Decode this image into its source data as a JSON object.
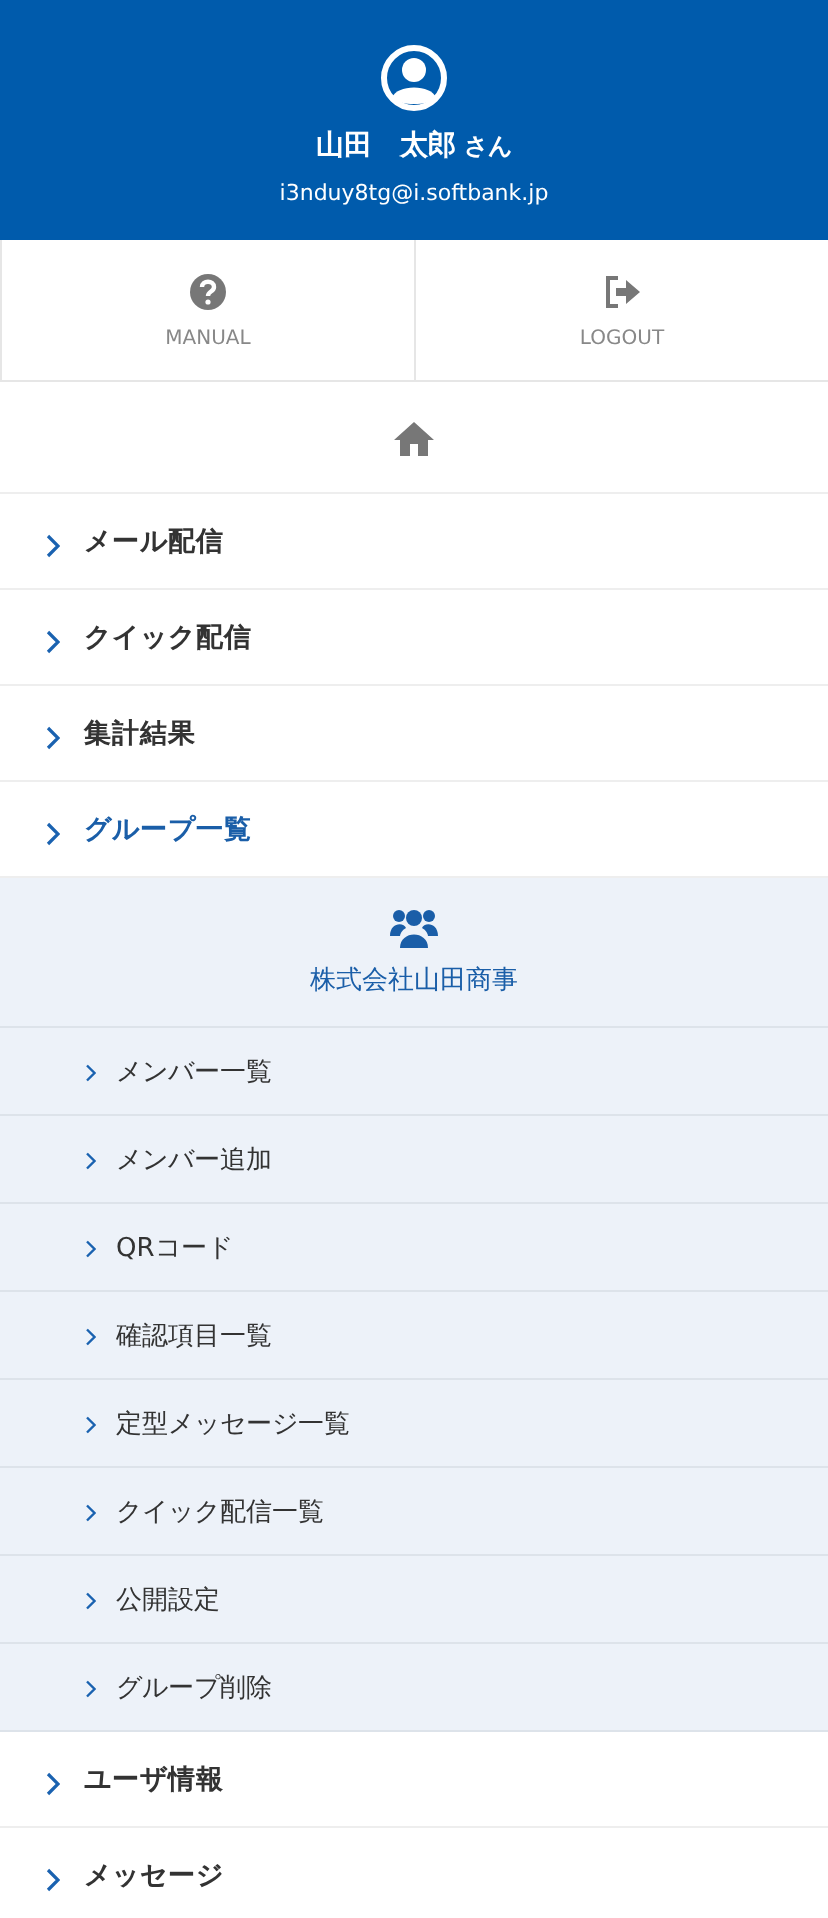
{
  "profile": {
    "name": "山田　太郎",
    "honorific": "さん",
    "email": "i3nduy8tg@i.softbank.jp"
  },
  "actions": [
    {
      "kind": "manual",
      "label": "MANUAL"
    },
    {
      "kind": "logout",
      "label": "LOGOUT"
    }
  ],
  "menu": [
    {
      "label": "メール配信",
      "selected": false
    },
    {
      "label": "クイック配信",
      "selected": false
    },
    {
      "label": "集計結果",
      "selected": false
    },
    {
      "label": "グループ一覧",
      "selected": true,
      "expanded": true,
      "group": {
        "name": "株式会社山田商事",
        "items": [
          "メンバー一覧",
          "メンバー追加",
          "QRコード",
          "確認項目一覧",
          "定型メッセージ一覧",
          "クイック配信一覧",
          "公開設定",
          "グループ削除"
        ]
      }
    },
    {
      "label": "ユーザ情報",
      "selected": false
    },
    {
      "label": "メッセージ",
      "selected": false
    }
  ]
}
